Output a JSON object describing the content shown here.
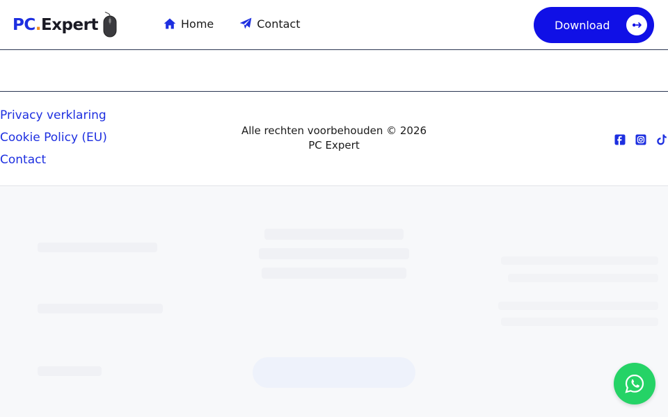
{
  "header": {
    "logo": {
      "pc": "PC",
      "dot": ".",
      "expert": "Expert"
    },
    "nav": [
      {
        "label": "Home",
        "icon": "home-icon"
      },
      {
        "label": "Contact",
        "icon": "paper-plane-icon"
      }
    ],
    "download_label": "Download"
  },
  "footer": {
    "links": [
      "Privacy verklaring",
      "Cookie Policy (EU)",
      "Contact"
    ],
    "copyright_line1": "Alle rechten voorbehouden © 2026",
    "copyright_line2": "PC Expert",
    "socials": [
      "facebook-icon",
      "instagram-icon",
      "tiktok-icon"
    ]
  },
  "colors": {
    "brand_blue": "#1d2fe0",
    "button_blue": "#1010e6",
    "whatsapp_green": "#25d366"
  }
}
